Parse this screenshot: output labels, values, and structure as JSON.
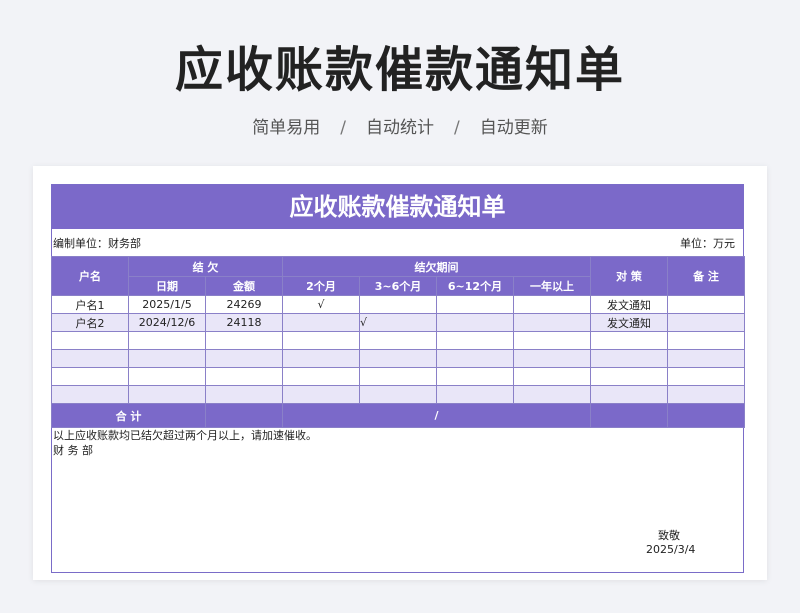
{
  "page": {
    "title": "应收账款催款通知单",
    "features": [
      "简单易用",
      "自动统计",
      "自动更新"
    ],
    "separator": "/"
  },
  "doc": {
    "title": "应收账款催款通知单",
    "unit_label": "编制单位：财务部",
    "currency_label": "单位：万元",
    "headers": {
      "customer": "户名",
      "outstanding": "结 欠",
      "period": "结欠期间",
      "strategy": "对 策",
      "remarks": "备 注",
      "date": "日期",
      "amount": "金额",
      "p1": "2个月",
      "p2": "3~6个月",
      "p3": "6~12个月",
      "p4": "一年以上"
    },
    "rows": [
      {
        "customer": "户名1",
        "date": "2025/1/5",
        "amount": "24269",
        "p1": "√",
        "p2": "",
        "p3": "",
        "p4": "",
        "strategy": "发文通知",
        "remarks": ""
      },
      {
        "customer": "户名2",
        "date": "2024/12/6",
        "amount": "24118",
        "p1": "",
        "p2": "√",
        "p3": "",
        "p4": "",
        "strategy": "发文通知",
        "remarks": ""
      },
      {
        "customer": "",
        "date": "",
        "amount": "",
        "p1": "",
        "p2": "",
        "p3": "",
        "p4": "",
        "strategy": "",
        "remarks": ""
      },
      {
        "customer": "",
        "date": "",
        "amount": "",
        "p1": "",
        "p2": "",
        "p3": "",
        "p4": "",
        "strategy": "",
        "remarks": ""
      },
      {
        "customer": "",
        "date": "",
        "amount": "",
        "p1": "",
        "p2": "",
        "p3": "",
        "p4": "",
        "strategy": "",
        "remarks": ""
      },
      {
        "customer": "",
        "date": "",
        "amount": "",
        "p1": "",
        "p2": "",
        "p3": "",
        "p4": "",
        "strategy": "",
        "remarks": ""
      }
    ],
    "total_label": "合 计",
    "total_value": "",
    "total_period": "/",
    "note": "以上应收账款均已结欠超过两个月以上，请加速催收。",
    "dept": "财 务 部",
    "closing": "致敬",
    "sign_date": "2025/3/4"
  }
}
